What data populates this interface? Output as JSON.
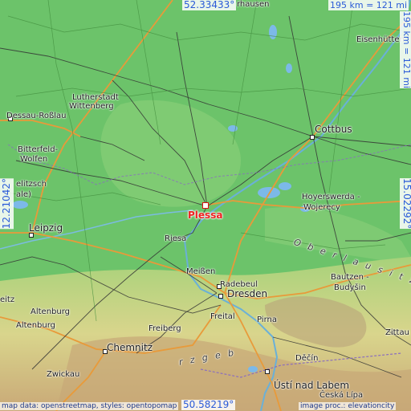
{
  "marker": {
    "label": "Plessa"
  },
  "coordinates": {
    "top": "52.33433°",
    "bottom": "50.58219°",
    "left": "12.21042°",
    "right": "15.02292°",
    "scale_h": "195 km = 121 mi",
    "scale_v": "195 km = 121 mi"
  },
  "labels": {
    "hausen": "rhausen",
    "eisenhuetten": "Eisenhütten",
    "lutherstadt": "Lutherstadt",
    "wittenberg": "Wittenberg",
    "dessau": "Dessau-Roßlau",
    "cottbus": "Cottbus",
    "bitterfeld": "Bitterfeld-",
    "wolfen": "Wolfen",
    "delitzsch": "elitzsch",
    "halle": "ale)",
    "hoyerswerda": "Hoyerswerda -",
    "wojerecy": "Wojerecy",
    "leipzig": "Leipzig",
    "riesa": "Riesa",
    "oberlausitz": "O b e r l a u s i t z",
    "meissen": "Meißen",
    "radebeul": "Radebeul",
    "dresden": "Dresden",
    "bautzen": "Bautzen -",
    "budysin": "Budyšin",
    "freital": "Freital",
    "pirna": "Pirna",
    "altenburg1": "Altenburg",
    "altenburg2": "Altenburg",
    "freiberg": "Freiberg",
    "zittau": "Zittau",
    "chemnitz": "Chemnitz",
    "zwickau": "Zwickau",
    "decin": "Děčín",
    "erzgebirge": "r z g e b",
    "usti": "Ústí nad Labem",
    "ceska": "Česká Lípa",
    "leitz": "eitz"
  },
  "attribution": {
    "left": "map data: openstreetmap, styles: opentopomap",
    "right": "image proc.: elevationcity"
  }
}
